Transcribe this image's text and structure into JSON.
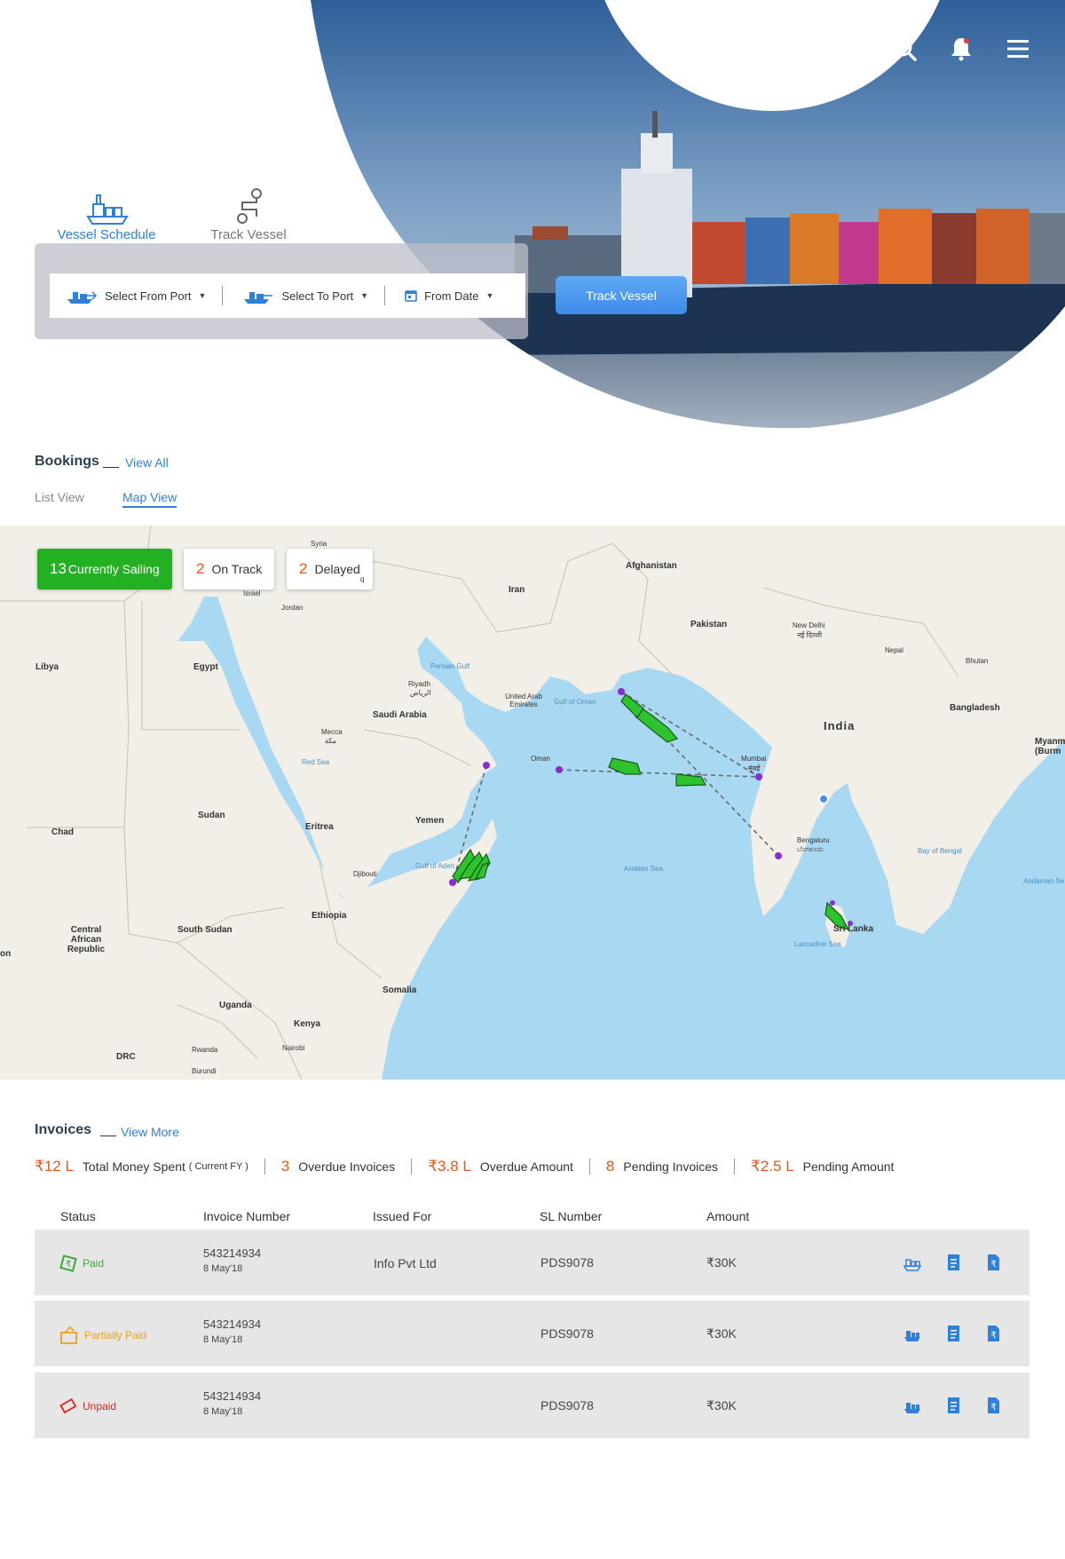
{
  "hero": {
    "tabs": [
      {
        "label": "Vessel Schedule",
        "active": true
      },
      {
        "label": "Track Vessel",
        "active": false
      }
    ],
    "search": {
      "from_port": "Select From Port",
      "to_port": "Select To Port",
      "from_date": "From Date",
      "button": "Track Vessel"
    },
    "icons": [
      "search-icon",
      "bell-icon",
      "menu-icon"
    ]
  },
  "bookings": {
    "title": "Bookings",
    "view_all": "View All",
    "views": [
      "List View",
      "Map View"
    ],
    "active_view": "Map View"
  },
  "map": {
    "stats": [
      {
        "count": "13",
        "label": "Currently Sailing"
      },
      {
        "count": "2",
        "label": "On Track"
      },
      {
        "count": "2",
        "label": "Delayed"
      }
    ],
    "labels": {
      "syria": "Syria",
      "iraq": "q",
      "israel": "Israel",
      "jordan": "Jordan",
      "afghanistan": "Afghanistan",
      "iran": "Iran",
      "pakistan": "Pakistan",
      "new_delhi": "New Delhi",
      "new_delhi_hi": "नई दिल्ली",
      "nepal": "Nepal",
      "bhutan": "Bhutan",
      "libya": "Libya",
      "egypt": "Egypt",
      "persian_gulf": "Persian Gulf",
      "riyadh": "Riyadh",
      "riyadh_ar": "الرياض",
      "saudi": "Saudi Arabia",
      "uae": "United Arab Emirates",
      "gulf_oman": "Gulf of Oman",
      "bangladesh": "Bangladesh",
      "india": "India",
      "myanmar": "Myanm (Burm",
      "mecca": "Mecca",
      "mecca_ar": "مكة",
      "red_sea": "Red Sea",
      "oman": "Oman",
      "mumbai": "Mumbai",
      "mumbai_mr": "मुंबई",
      "sudan": "Sudan",
      "chad": "Chad",
      "eritrea": "Eritrea",
      "yemen": "Yemen",
      "bengaluru": "Bengaluru",
      "bengaluru_kn": "ಬೆಂಗಳೂರು",
      "bay_bengal": "Bay of Bengal",
      "gulf_aden": "Gulf of Aden",
      "djibouti": "Djibouti",
      "arabian_sea": "Arabian Sea",
      "andaman": "Andaman Se",
      "ethiopia": "Ethiopia",
      "sri_lanka": "Sri Lanka",
      "car": "Central African Republic",
      "south_sudan": "South Sudan",
      "laccadive": "Laccadive Sea",
      "on": "on",
      "somalia": "Somalia",
      "uganda": "Uganda",
      "kenya": "Kenya",
      "rwanda": "Rwanda",
      "nairobi": "Nairobi",
      "drc": "DRC",
      "burundi": "Burundi"
    }
  },
  "invoices": {
    "title": "Invoices",
    "view_more": "View More",
    "summary": [
      {
        "amount": "₹12 L",
        "label": "Total Money Spent",
        "note": "( Current FY )"
      },
      {
        "amount": "3",
        "label": "Overdue Invoices"
      },
      {
        "amount": "₹3.8 L",
        "label": "Overdue Amount"
      },
      {
        "amount": "8",
        "label": "Pending Invoices"
      },
      {
        "amount": "₹2.5 L",
        "label": "Pending Amount"
      }
    ],
    "columns": [
      "Status",
      "Invoice Number",
      "Issued For",
      "SL Number",
      "Amount"
    ],
    "rows": [
      {
        "status": "Paid",
        "status_color": "#3aaa35",
        "invoice": "543214934",
        "date": "8 May'18",
        "issued_for": "Info Pvt Ltd",
        "sl": "PDS9078",
        "amount": "₹30K"
      },
      {
        "status": "Partially Paid",
        "status_color": "#f0a020",
        "invoice": "543214934",
        "date": "8 May'18",
        "issued_for": "",
        "sl": "PDS9078",
        "amount": "₹30K"
      },
      {
        "status": "Unpaid",
        "status_color": "#d9261c",
        "invoice": "543214934",
        "date": "8 May'18",
        "issued_for": "",
        "sl": "PDS9078",
        "amount": "₹30K"
      }
    ],
    "row_actions": [
      "ship-icon",
      "document-icon",
      "rupee-document-icon"
    ]
  },
  "colors": {
    "accent": "#2f80d9",
    "orange": "#e2571e",
    "green": "#23b123"
  }
}
